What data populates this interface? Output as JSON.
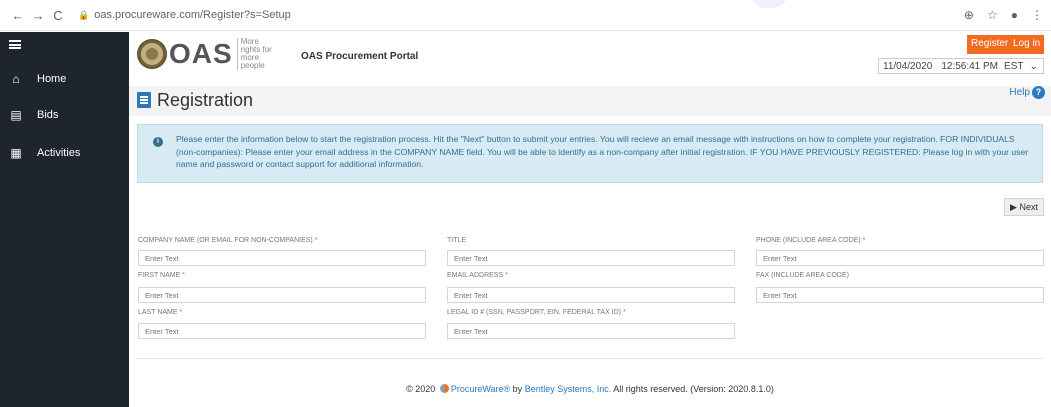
{
  "browser": {
    "back": "←",
    "forward": "→",
    "reload": "C",
    "url": "oas.procureware.com/Register?s=Setup",
    "zoom_icon": "⊕",
    "star_icon": "☆",
    "profile_icon": "●",
    "menu_icon": "⋮"
  },
  "sidebar": {
    "items": [
      {
        "label": "Home",
        "icon": "home-icon"
      },
      {
        "label": "Bids",
        "icon": "calculator-icon"
      },
      {
        "label": "Activities",
        "icon": "calendar-icon"
      }
    ]
  },
  "header": {
    "logo_text": "OAS",
    "motto": "More rights for more people",
    "portal_title": "OAS Procurement Portal",
    "register_label": "Register",
    "login_label": "Log in",
    "date": "11/04/2020",
    "time": "12:56:41 PM",
    "timezone": "EST",
    "timezone_arrow": "⌄"
  },
  "page": {
    "title": "Registration",
    "help_label": "Help",
    "help_icon": "?"
  },
  "info": {
    "icon": "i",
    "text": "Please enter the information below to start the registration process. Hit the \"Next\" button to submit your entries. You will recieve an email message with instructions on how to complete your registration. FOR INDIVIDUALS (non-companies): Please enter your email address in the COMPANY NAME field. You will be able to identify as a non-company after initial registration. IF YOU HAVE PREVIOUSLY REGISTERED: Please log in with your user name and password or contact support for additional information."
  },
  "next_label": "▶ Next",
  "form": {
    "required_marker": "*",
    "placeholder": "Enter Text",
    "fields": {
      "company": "COMPANY NAME (OR EMAIL FOR NON-COMPANIES)",
      "first_name": "FIRST NAME",
      "last_name": "LAST NAME",
      "title": "TITLE",
      "email": "EMAIL ADDRESS",
      "legal_id": "LEGAL ID # (SSN, PASSPORT, EIN, FEDERAL TAX ID)",
      "phone": "PHONE (INCLUDE AREA CODE)",
      "fax": "FAX (INCLUDE AREA CODE)"
    }
  },
  "footer": {
    "copyright": "© 2020",
    "product": "ProcureWare®",
    "by": "by",
    "company": "Bentley Systems, Inc.",
    "rights": "All rights reserved. (Version: 2020.8.1.0)"
  },
  "colors": {
    "sidebar": "#1f252d",
    "accent_orange": "#f26b21",
    "link_blue": "#2b7ac0",
    "info_bg": "#d8eaf3"
  }
}
